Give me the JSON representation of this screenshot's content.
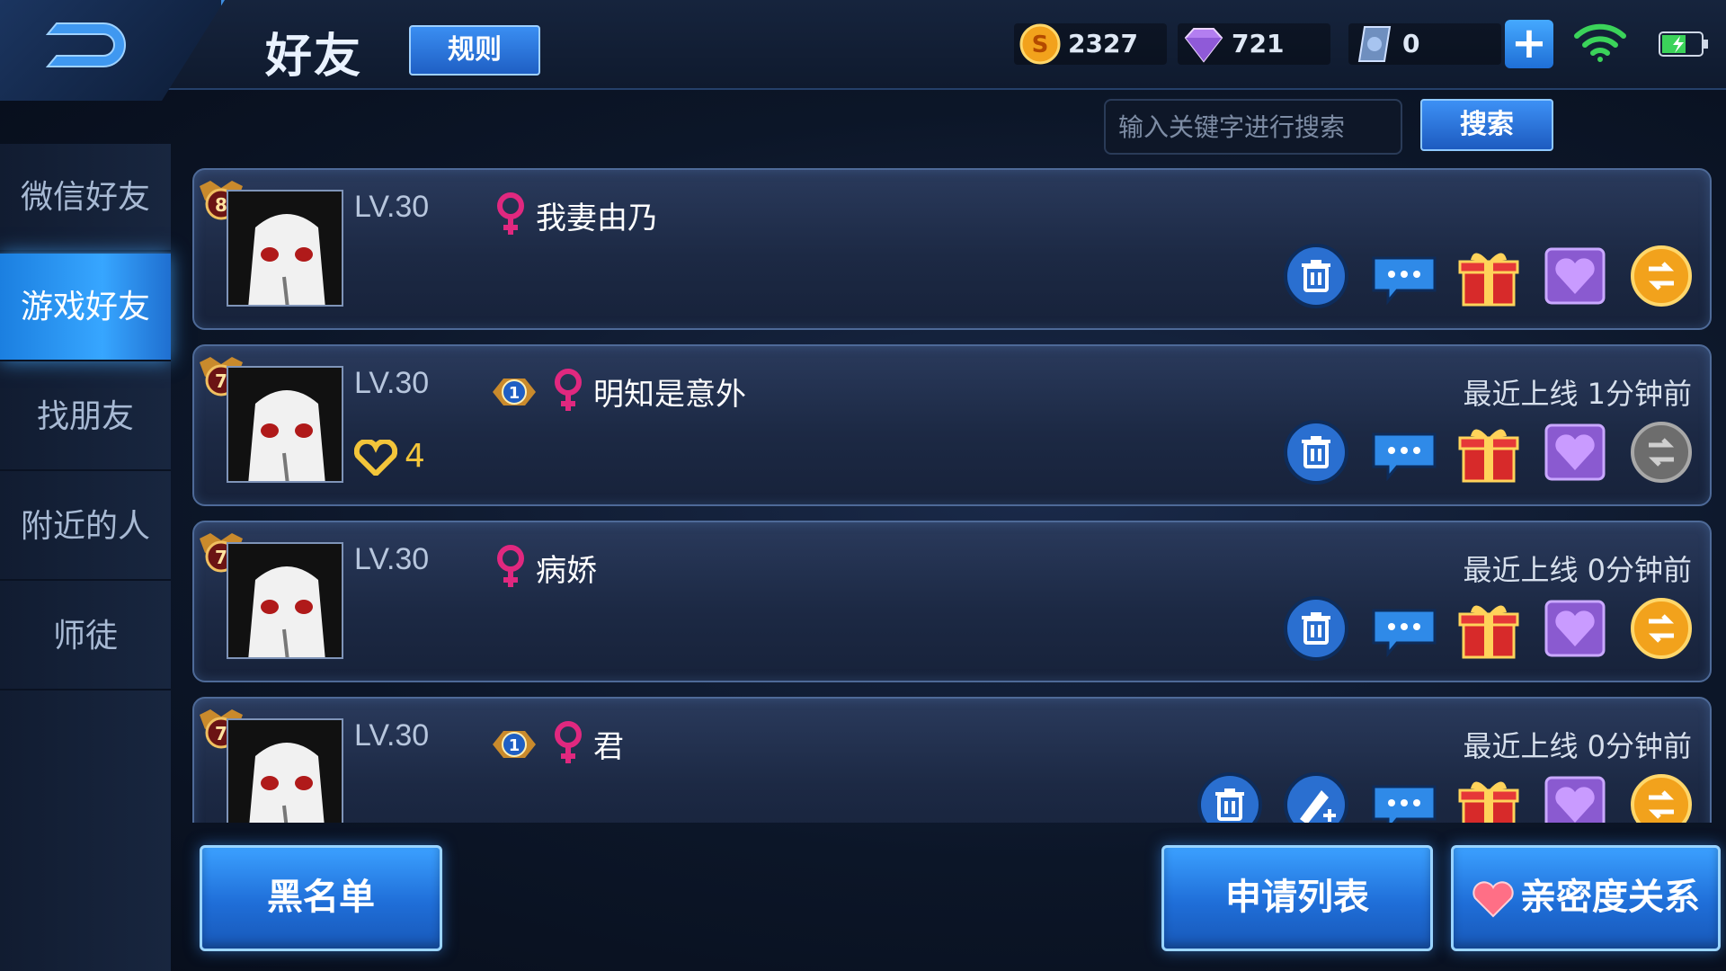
{
  "header": {
    "title": "好友",
    "rules_label": "规则",
    "currencies": {
      "gold": "2327",
      "diamond": "721",
      "voucher": "0"
    }
  },
  "sidebar": {
    "items": [
      {
        "label": "微信好友",
        "active": false
      },
      {
        "label": "游戏好友",
        "active": true
      },
      {
        "label": "找朋友",
        "active": false
      },
      {
        "label": "附近的人",
        "active": false
      },
      {
        "label": "师徒",
        "active": false
      }
    ]
  },
  "search": {
    "placeholder": "输入关键字进行搜索",
    "button_label": "搜索"
  },
  "friends": [
    {
      "rank": "8",
      "level": "LV.30",
      "name": "我妻由乃",
      "segment": "",
      "last_online": "",
      "intimacy": ""
    },
    {
      "rank": "7",
      "level": "LV.30",
      "name": "明知是意外",
      "segment": "1",
      "last_online": "最近上线  1分钟前",
      "intimacy": "4"
    },
    {
      "rank": "7",
      "level": "LV.30",
      "name": "病娇",
      "segment": "",
      "last_online": "最近上线  0分钟前",
      "intimacy": ""
    },
    {
      "rank": "7",
      "level": "LV.30",
      "name": "君",
      "segment": "1",
      "last_online": "最近上线  0分钟前",
      "intimacy": ""
    }
  ],
  "footer": {
    "blacklist_label": "黑名单",
    "requests_label": "申请列表",
    "intimacy_label": "亲密度关系"
  },
  "colors": {
    "accent": "#2f86ea",
    "female": "#e0287f",
    "gold": "#f3c53a"
  }
}
